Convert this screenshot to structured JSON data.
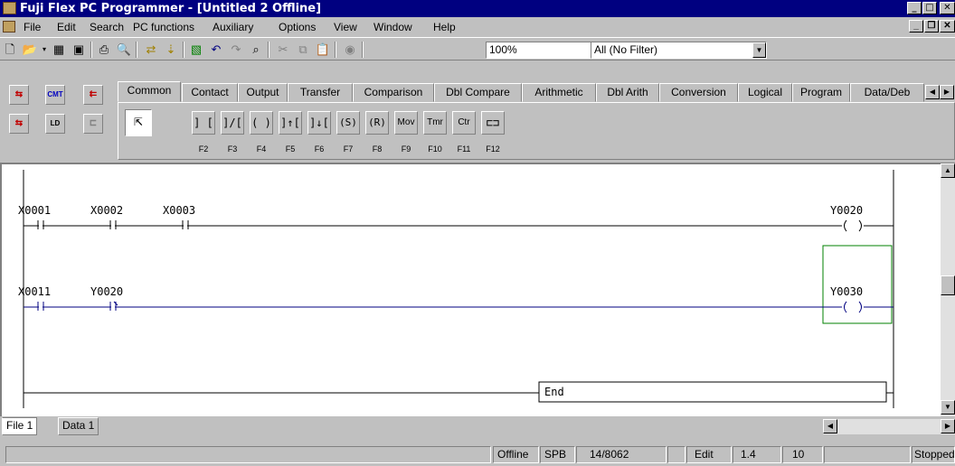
{
  "window": {
    "title": "Fuji Flex PC Programmer - [Untitled 2 Offline]"
  },
  "menu": [
    "File",
    "Edit",
    "Search",
    "PC functions",
    "Auxiliary",
    "Options",
    "View",
    "Window",
    "Help"
  ],
  "toolbar": {
    "zoom": "100%",
    "filter": "All (No Filter)"
  },
  "palette": {
    "tabs": [
      "Common",
      "Contact",
      "Output",
      "Transfer",
      "Comparison",
      "Dbl Compare",
      "Arithmetic",
      "Dbl Arith",
      "Conversion",
      "Logical",
      "Program",
      "Data/Deb"
    ],
    "active_tab": "Common",
    "instructions": [
      {
        "symbol": "] [",
        "fkey": "F2"
      },
      {
        "symbol": "]/[",
        "fkey": "F3"
      },
      {
        "symbol": "( )",
        "fkey": "F4"
      },
      {
        "symbol": "]↑[",
        "fkey": "F5"
      },
      {
        "symbol": "]↓[",
        "fkey": "F6"
      },
      {
        "symbol": "(S)",
        "fkey": "F7"
      },
      {
        "symbol": "(R)",
        "fkey": "F8"
      },
      {
        "symbol": "Mov",
        "fkey": "F9"
      },
      {
        "symbol": "Tmr",
        "fkey": "F10"
      },
      {
        "symbol": "Ctr",
        "fkey": "F11"
      },
      {
        "symbol": "⊏⊐",
        "fkey": "F12"
      }
    ]
  },
  "ladder": {
    "rungs": [
      {
        "contacts": [
          "X0001",
          "X0002",
          "X0003"
        ],
        "coil": "Y0020"
      },
      {
        "contacts": [
          "X0011",
          "Y0020"
        ],
        "coil": "Y0030"
      }
    ],
    "end_label": "End"
  },
  "bottom_tabs": [
    "File 1",
    "Data 1"
  ],
  "status": {
    "mode": "Offline",
    "type": "SPB",
    "steps": "14/8062",
    "edit": "Edit",
    "version": "1.4",
    "value": "10",
    "run": "Stopped"
  }
}
